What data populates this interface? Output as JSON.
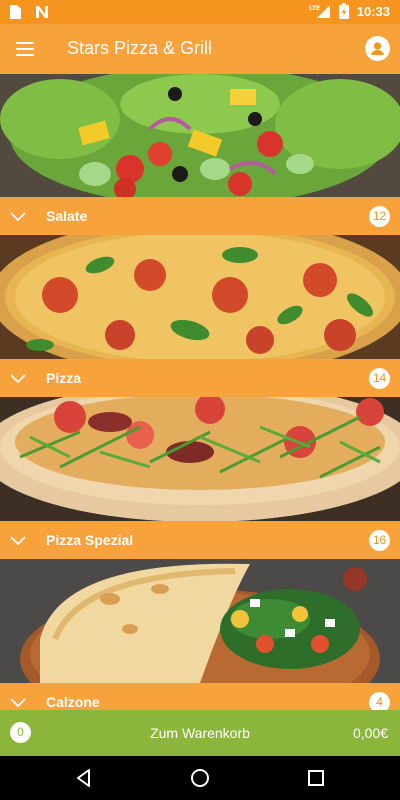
{
  "status_bar": {
    "time": "10:33",
    "network_label": "LTE",
    "icons": [
      "sim-card-icon",
      "notification-n-icon",
      "lte-signal-icon",
      "battery-charging-icon"
    ]
  },
  "app_bar": {
    "title": "Stars Pizza & Grill",
    "menu_icon": "hamburger-menu-icon",
    "account_icon": "account-icon"
  },
  "categories": [
    {
      "label": "Salate",
      "count": "12",
      "image": "salad-photo"
    },
    {
      "label": "Pizza",
      "count": "14",
      "image": "pizza-photo"
    },
    {
      "label": "Pizza Spezial",
      "count": "16",
      "image": "pizza-spezial-photo"
    },
    {
      "label": "Calzone",
      "count": "4",
      "image": "calzone-photo"
    }
  ],
  "cart": {
    "count": "0",
    "label": "Zum Warenkorb",
    "total": "0,00€"
  },
  "nav_bar": {
    "icons": [
      "back-icon",
      "home-icon",
      "recents-icon"
    ]
  },
  "colors": {
    "status_bar": "#f5941e",
    "app_bar": "#f7a23a",
    "cart_bar": "#8bb53b",
    "nav_bar": "#000000"
  }
}
